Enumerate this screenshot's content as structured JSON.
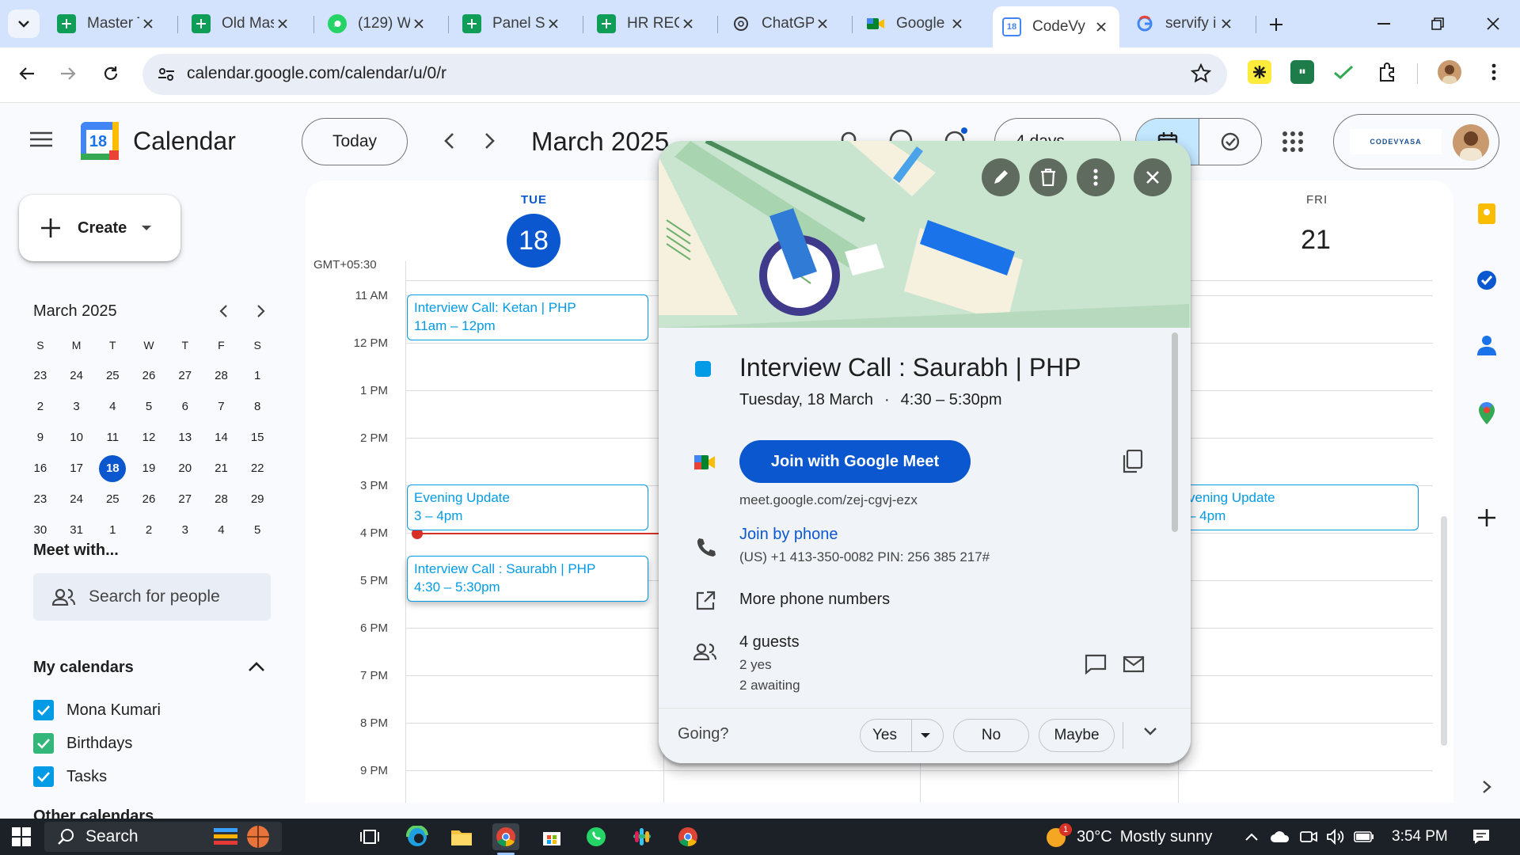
{
  "browser": {
    "tabs": [
      {
        "title": "Master T",
        "icon": "sheets-icon",
        "active": false
      },
      {
        "title": "Old Mas",
        "icon": "sheets-icon",
        "active": false
      },
      {
        "title": "(129) W",
        "icon": "whatsapp-icon",
        "active": false
      },
      {
        "title": "Panel Sh",
        "icon": "sheets-icon",
        "active": false
      },
      {
        "title": "HR REC",
        "icon": "sheets-icon",
        "active": false
      },
      {
        "title": "ChatGP",
        "icon": "chatgpt-icon",
        "active": false
      },
      {
        "title": "Google",
        "icon": "google-meet-icon",
        "active": false
      },
      {
        "title": "CodeVy",
        "icon": "calendar-icon",
        "active": true
      },
      {
        "title": "servify i",
        "icon": "google-icon",
        "active": false
      }
    ],
    "url": "calendar.google.com/calendar/u/0/r"
  },
  "header": {
    "app_name": "Calendar",
    "logo_day": "18",
    "today_label": "Today",
    "month_title": "March 2025",
    "view_label": "4 days",
    "org_logo_text": "CODEVYASA"
  },
  "sidebar": {
    "create_label": "Create",
    "mini_title": "March 2025",
    "weekday_heads": [
      "S",
      "M",
      "T",
      "W",
      "T",
      "F",
      "S"
    ],
    "weeks": [
      [
        "23",
        "24",
        "25",
        "26",
        "27",
        "28",
        "1"
      ],
      [
        "2",
        "3",
        "4",
        "5",
        "6",
        "7",
        "8"
      ],
      [
        "9",
        "10",
        "11",
        "12",
        "13",
        "14",
        "15"
      ],
      [
        "16",
        "17",
        "18",
        "19",
        "20",
        "21",
        "22"
      ],
      [
        "23",
        "24",
        "25",
        "26",
        "27",
        "28",
        "29"
      ],
      [
        "30",
        "31",
        "1",
        "2",
        "3",
        "4",
        "5"
      ]
    ],
    "today_day": "18",
    "meet_with": "Meet with...",
    "search_people_placeholder": "Search for people",
    "my_calendars": "My calendars",
    "calendars": [
      {
        "name": "Mona Kumari",
        "color": "#039be5"
      },
      {
        "name": "Birthdays",
        "color": "#33b679"
      },
      {
        "name": "Tasks",
        "color": "#039be5"
      }
    ],
    "other_calendars": "Other calendars"
  },
  "grid": {
    "timezone": "GMT+05:30",
    "day1": {
      "weekday": "TUE",
      "date": "18"
    },
    "day4": {
      "weekday": "FRI",
      "date": "21"
    },
    "hours": [
      "11 AM",
      "12 PM",
      "1 PM",
      "2 PM",
      "3 PM",
      "4 PM",
      "5 PM",
      "6 PM",
      "7 PM",
      "8 PM",
      "9 PM"
    ],
    "events": [
      {
        "title": "Interview Call: Ketan | PHP",
        "time": "11am – 12pm"
      },
      {
        "title": "Evening Update",
        "time": "3 – 4pm"
      },
      {
        "title": "Interview Call : Saurabh | PHP",
        "time": "4:30 – 5:30pm"
      },
      {
        "title": "vening Update",
        "time": "– 4pm"
      }
    ]
  },
  "popup": {
    "title": "Interview Call : Saurabh | PHP",
    "date": "Tuesday, 18 March",
    "time": "4:30 – 5:30pm",
    "meet_button": "Join with Google Meet",
    "meet_link": "meet.google.com/zej-cgvj-ezx",
    "join_phone": "Join by phone",
    "phone_detail": "(US) +1 413-350-0082 PIN: 256 385 217#",
    "more_phones": "More phone numbers",
    "guests": "4 guests",
    "guests_yes": "2 yes",
    "guests_awaiting": "2 awaiting",
    "going": "Going?",
    "yes": "Yes",
    "no": "No",
    "maybe": "Maybe",
    "accent": "#0b57d0"
  },
  "taskbar": {
    "search": "Search",
    "weather_temp": "30°C",
    "weather_text": "Mostly sunny",
    "weather_badge": "1",
    "clock": "3:54 PM"
  }
}
